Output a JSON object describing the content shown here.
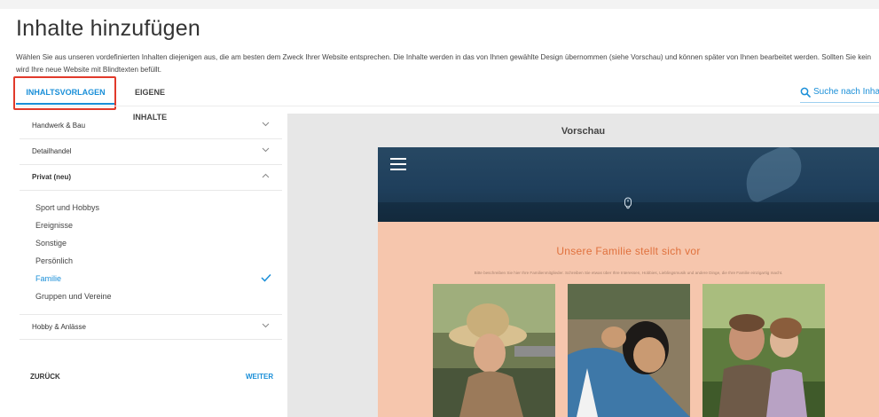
{
  "header": {
    "title": "Inhalte hinzufügen",
    "intro_line1": "Wählen Sie aus unseren vordefinierten Inhalten diejenigen aus, die am besten dem Zweck Ihrer Website entsprechen. Die Inhalte werden in das von Ihnen gewählte Design übernommen (siehe Vorschau) und können später von Ihnen bearbeitet werden. Sollten Sie kein",
    "intro_line2": "wird Ihre neue Website mit Blindtexten befüllt."
  },
  "tabs": [
    {
      "label": "INHALTSVORLAGEN",
      "active": true
    },
    {
      "label": "EIGENE INHALTE",
      "active": false
    }
  ],
  "search": {
    "label": "Suche nach Inhal",
    "icon": "search-icon"
  },
  "sidebar": {
    "categories": [
      {
        "label": "Handwerk & Bau",
        "expanded": false
      },
      {
        "label": "Detailhandel",
        "expanded": false
      },
      {
        "label": "Privat (neu)",
        "expanded": true
      },
      {
        "label": "Hobby & Anlässe",
        "expanded": false
      }
    ],
    "subitems": [
      {
        "label": "Sport und Hobbys",
        "selected": false
      },
      {
        "label": "Ereignisse",
        "selected": false
      },
      {
        "label": "Sonstige",
        "selected": false
      },
      {
        "label": "Persönlich",
        "selected": false
      },
      {
        "label": "Familie",
        "selected": true
      },
      {
        "label": "Gruppen und Vereine",
        "selected": false
      }
    ],
    "back_label": "ZURÜCK",
    "next_label": "WEITER"
  },
  "preview": {
    "title": "Vorschau",
    "site": {
      "heading": "Unsere Familie stellt sich vor",
      "text": "Bitte beschreiben Sie hier Ihre Familienmitglieder. Schreiben Sie etwas über Ihre Interessen, Hobbies, Lieblingsmusik und andere Dinge, die Ihre Familie einzigartig macht."
    }
  },
  "colors": {
    "accent": "#1a8fd8",
    "highlight_box": "#e13a2b",
    "preview_bg": "#f6c6ad",
    "preview_heading": "#e0713d",
    "header_dark": "#1f3f5c"
  }
}
